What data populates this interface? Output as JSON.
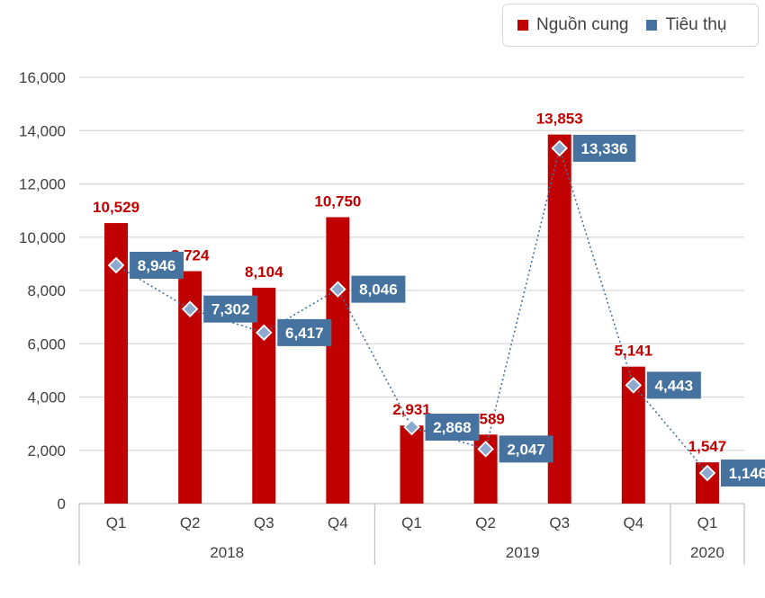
{
  "legend": {
    "supply_label": "Nguồn cung",
    "consumption_label": "Tiêu thụ"
  },
  "colors": {
    "supply": "#c00000",
    "consumption": "#45729e",
    "grid": "#d9d9d9",
    "axis_text": "#404040"
  },
  "chart_data": {
    "type": "bar",
    "categories": [
      "Q1",
      "Q2",
      "Q3",
      "Q4",
      "Q1",
      "Q2",
      "Q3",
      "Q4",
      "Q1"
    ],
    "groups": [
      {
        "label": "2018",
        "count": 4
      },
      {
        "label": "2019",
        "count": 4
      },
      {
        "label": "2020",
        "count": 1
      }
    ],
    "series": [
      {
        "name": "Nguồn cung",
        "kind": "bar",
        "values": [
          10529,
          8724,
          8104,
          10750,
          2931,
          2589,
          13853,
          5141,
          1547
        ]
      },
      {
        "name": "Tiêu thụ",
        "kind": "line-marker",
        "values": [
          8946,
          7302,
          6417,
          8046,
          2868,
          2047,
          13336,
          4443,
          1146
        ]
      }
    ],
    "value_labels": {
      "supply": [
        "10,529",
        "8,724",
        "8,104",
        "10,750",
        "2,931",
        "2,589",
        "13,853",
        "5,141",
        "1,547"
      ],
      "consumption": [
        "8,946",
        "7,302",
        "6,417",
        "8,046",
        "2,868",
        "2,047",
        "13,336",
        "4,443",
        "1,146"
      ]
    },
    "ylim": [
      0,
      16000
    ],
    "yticks": [
      0,
      2000,
      4000,
      6000,
      8000,
      10000,
      12000,
      14000,
      16000
    ],
    "ytick_labels": [
      "0",
      "2,000",
      "4,000",
      "6,000",
      "8,000",
      "10,000",
      "12,000",
      "14,000",
      "16,000"
    ],
    "grid": true,
    "legend_position": "top-right",
    "title": "",
    "xlabel": "",
    "ylabel": ""
  }
}
